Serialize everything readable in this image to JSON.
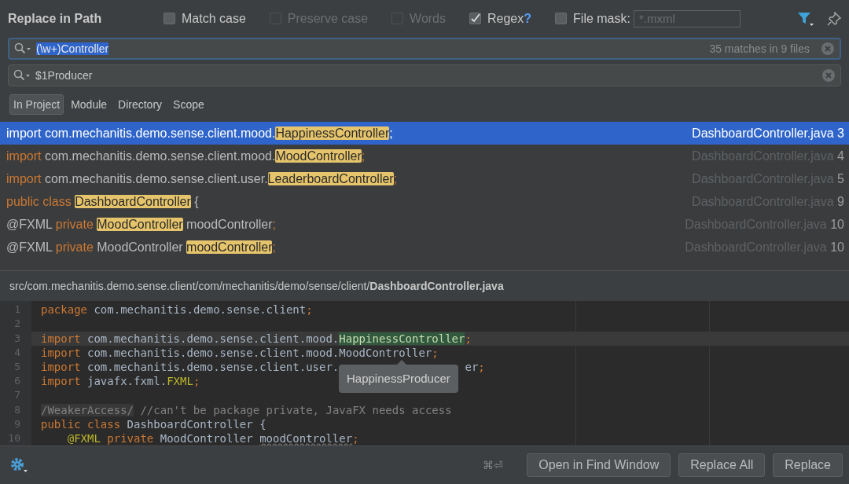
{
  "dialog": {
    "title": "Replace in Path"
  },
  "options": [
    {
      "label": "Match case",
      "checked": false,
      "disabled": false
    },
    {
      "label": "Preserve case",
      "checked": false,
      "disabled": true
    },
    {
      "label": "Words",
      "checked": false,
      "disabled": true
    },
    {
      "label": "Regex",
      "checked": true,
      "disabled": false,
      "help": "?"
    }
  ],
  "file_mask": {
    "label": "File mask:",
    "checked": false,
    "placeholder": "*.mxml"
  },
  "search": {
    "value": "(\\w+)Controller",
    "text_selected": true,
    "match_count": "35 matches in 9 files"
  },
  "replace": {
    "value": "$1Producer"
  },
  "scopes": [
    {
      "label": "In Project",
      "selected": true
    },
    {
      "label": "Module",
      "selected": false
    },
    {
      "label": "Directory",
      "selected": false
    },
    {
      "label": "Scope",
      "selected": false
    }
  ],
  "results": [
    {
      "selected": true,
      "segments": [
        {
          "kind": "keyword",
          "text": "import"
        },
        {
          "kind": "plain",
          "text": " com.mechanitis.demo.sense.client.mood."
        },
        {
          "kind": "match",
          "text": "HappinessController"
        },
        {
          "kind": "plain",
          "text": ";"
        }
      ],
      "file": "DashboardController.java",
      "line": "3"
    },
    {
      "selected": false,
      "segments": [
        {
          "kind": "keyword",
          "text": "import"
        },
        {
          "kind": "plain",
          "text": " com.mechanitis.demo.sense.client.mood."
        },
        {
          "kind": "match",
          "text": "MoodController"
        },
        {
          "kind": "keyword",
          "text": ";"
        }
      ],
      "file": "DashboardController.java",
      "line": "4"
    },
    {
      "selected": false,
      "segments": [
        {
          "kind": "keyword",
          "text": "import"
        },
        {
          "kind": "plain",
          "text": " com.mechanitis.demo.sense.client.user."
        },
        {
          "kind": "match",
          "text": "LeaderboardController"
        },
        {
          "kind": "keyword",
          "text": ";"
        }
      ],
      "file": "DashboardController.java",
      "line": "5"
    },
    {
      "selected": false,
      "segments": [
        {
          "kind": "keyword",
          "text": "public class "
        },
        {
          "kind": "match",
          "text": "DashboardController"
        },
        {
          "kind": "plain",
          "text": " {"
        }
      ],
      "file": "DashboardController.java",
      "line": "9"
    },
    {
      "selected": false,
      "segments": [
        {
          "kind": "plain",
          "text": "@FXML"
        },
        {
          "kind": "keyword",
          "text": " private "
        },
        {
          "kind": "match",
          "text": "MoodController"
        },
        {
          "kind": "plain",
          "text": " moodController"
        },
        {
          "kind": "keyword",
          "text": ";"
        }
      ],
      "file": "DashboardController.java",
      "line": "10"
    },
    {
      "selected": false,
      "segments": [
        {
          "kind": "plain",
          "text": "@FXML"
        },
        {
          "kind": "keyword",
          "text": " private "
        },
        {
          "kind": "plain",
          "text": "MoodController "
        },
        {
          "kind": "match",
          "text": "moodController"
        },
        {
          "kind": "keyword",
          "text": ";"
        }
      ],
      "file": "DashboardController.java",
      "line": "10"
    }
  ],
  "preview": {
    "path": "src/com.mechanitis.demo.sense.client/com/mechanitis/demo/sense/client/**DashboardController.java**"
  },
  "code": [
    {
      "number": "1",
      "current": false,
      "segments": [
        {
          "kind": "keyword",
          "text": "package"
        },
        {
          "kind": "plain",
          "text": " com.mechanitis.demo.sense.client"
        },
        {
          "kind": "keyword",
          "text": ";"
        }
      ]
    },
    {
      "number": "2",
      "current": false
    },
    {
      "number": "3",
      "current": true,
      "segments": [
        {
          "kind": "keyword",
          "text": "import"
        },
        {
          "kind": "plain",
          "text": " com.mechanitis.demo.sense.client.mood."
        },
        {
          "kind": "found",
          "text": "HappinessController"
        },
        {
          "kind": "keyword",
          "text": ";"
        }
      ]
    },
    {
      "number": "4",
      "current": false,
      "segments": [
        {
          "kind": "keyword",
          "text": "import"
        },
        {
          "kind": "plain",
          "text": " com.mechanitis.demo.sense.client.mood.MoodController"
        },
        {
          "kind": "keyword",
          "text": ";"
        }
      ]
    },
    {
      "number": "5",
      "current": false,
      "segments": [
        {
          "kind": "keyword",
          "text": "import"
        },
        {
          "kind": "plain",
          "text": " com.mechanitis.demo.sense.client.user."
        },
        {
          "kind": "gap"
        },
        {
          "kind": "plain",
          "text": "er"
        },
        {
          "kind": "keyword",
          "text": ";"
        }
      ]
    },
    {
      "number": "6",
      "current": false,
      "segments": [
        {
          "kind": "keyword",
          "text": "import"
        },
        {
          "kind": "plain",
          "text": " javafx.fxml."
        },
        {
          "kind": "annotation",
          "text": "FXML"
        },
        {
          "kind": "keyword",
          "text": ";"
        }
      ]
    },
    {
      "number": "7",
      "current": false
    },
    {
      "number": "8",
      "current": false,
      "segments": [
        {
          "kind": "suppressed",
          "text": "/WeakerAccess/"
        },
        {
          "kind": "comment",
          "text": " //can't be package private, JavaFX needs access"
        }
      ]
    },
    {
      "number": "9",
      "current": false,
      "segments": [
        {
          "kind": "keyword",
          "text": "public class"
        },
        {
          "kind": "plain",
          "text": " DashboardController {"
        }
      ]
    },
    {
      "number": "10",
      "current": false,
      "segments": [
        {
          "kind": "indent"
        },
        {
          "kind": "annotation",
          "text": "@FXML"
        },
        {
          "kind": "keyword",
          "text": " private"
        },
        {
          "kind": "plain",
          "text": " MoodController "
        },
        {
          "kind": "unused",
          "text": "moodController"
        },
        {
          "kind": "keyword",
          "text": ";"
        }
      ]
    }
  ],
  "tooltip": "HappinessProducer",
  "shortcut": "⌘⏎",
  "buttons": [
    "Open in Find Window",
    "Replace All",
    "Replace"
  ]
}
